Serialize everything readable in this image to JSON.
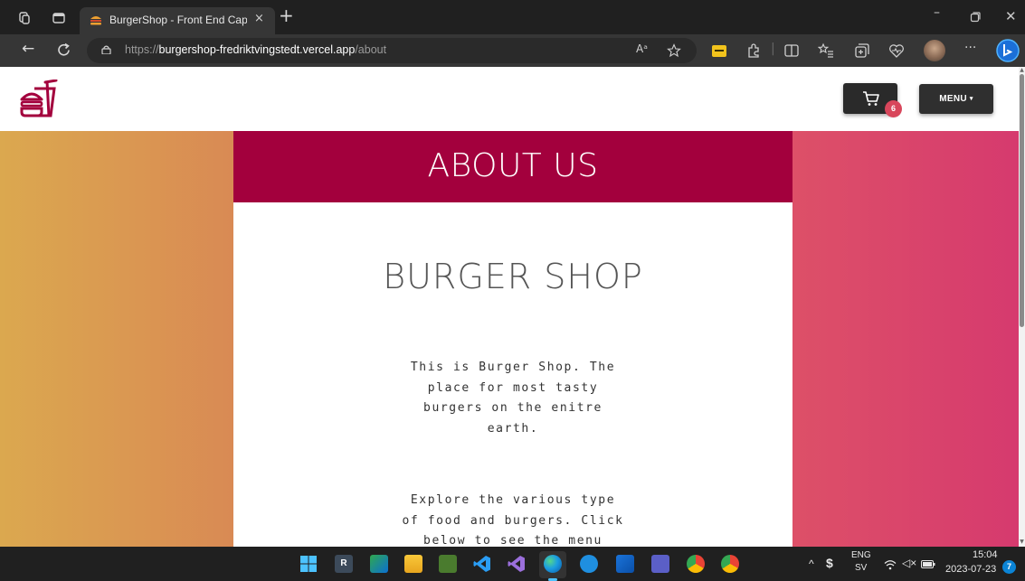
{
  "browser": {
    "tab_title": "BurgerShop - Front End Capstone",
    "tab_close": "×",
    "new_tab": "+",
    "url": {
      "scheme": "https://",
      "host": "burgershop-fredriktvingstedt.vercel.app",
      "path": "/about"
    },
    "read_aloud": "Aᵃ",
    "more": "···"
  },
  "site": {
    "cart_count": "6",
    "menu_label": "MENU",
    "menu_caret": "▾",
    "banner_title": "ABOUT US",
    "shop_title": "BURGER SHOP",
    "paragraphs": [
      [
        "This is Burger Shop. The",
        "place for most tasty",
        "burgers on the enitre",
        "earth."
      ],
      [
        "Explore the various type",
        "of food and burgers. Click",
        "below to see the menu"
      ]
    ]
  },
  "taskbar": {
    "language": "ENG",
    "layout": "SV",
    "time": "15:04",
    "date": "2023-07-23",
    "notifications": "7"
  },
  "colors": {
    "banner": "#a3003d",
    "logo": "#a3003d",
    "badge": "#d8465b",
    "gradient_left": [
      "#dba84f",
      "#d98a54"
    ],
    "gradient_right": [
      "#dd5068",
      "#d63a6e"
    ]
  }
}
